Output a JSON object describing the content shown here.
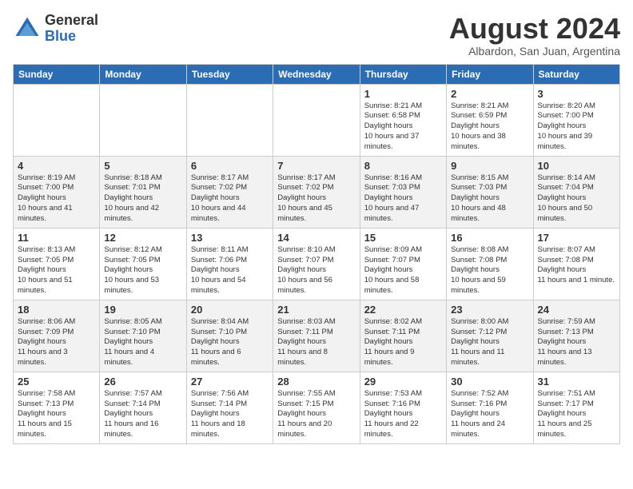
{
  "header": {
    "logo_general": "General",
    "logo_blue": "Blue",
    "month_title": "August 2024",
    "location": "Albardon, San Juan, Argentina"
  },
  "weekdays": [
    "Sunday",
    "Monday",
    "Tuesday",
    "Wednesday",
    "Thursday",
    "Friday",
    "Saturday"
  ],
  "weeks": [
    [
      null,
      null,
      null,
      null,
      {
        "day": 1,
        "sunrise": "8:21 AM",
        "sunset": "6:58 PM",
        "daylight": "10 hours and 37 minutes."
      },
      {
        "day": 2,
        "sunrise": "8:21 AM",
        "sunset": "6:59 PM",
        "daylight": "10 hours and 38 minutes."
      },
      {
        "day": 3,
        "sunrise": "8:20 AM",
        "sunset": "7:00 PM",
        "daylight": "10 hours and 39 minutes."
      }
    ],
    [
      {
        "day": 4,
        "sunrise": "8:19 AM",
        "sunset": "7:00 PM",
        "daylight": "10 hours and 41 minutes."
      },
      {
        "day": 5,
        "sunrise": "8:18 AM",
        "sunset": "7:01 PM",
        "daylight": "10 hours and 42 minutes."
      },
      {
        "day": 6,
        "sunrise": "8:17 AM",
        "sunset": "7:02 PM",
        "daylight": "10 hours and 44 minutes."
      },
      {
        "day": 7,
        "sunrise": "8:17 AM",
        "sunset": "7:02 PM",
        "daylight": "10 hours and 45 minutes."
      },
      {
        "day": 8,
        "sunrise": "8:16 AM",
        "sunset": "7:03 PM",
        "daylight": "10 hours and 47 minutes."
      },
      {
        "day": 9,
        "sunrise": "8:15 AM",
        "sunset": "7:03 PM",
        "daylight": "10 hours and 48 minutes."
      },
      {
        "day": 10,
        "sunrise": "8:14 AM",
        "sunset": "7:04 PM",
        "daylight": "10 hours and 50 minutes."
      }
    ],
    [
      {
        "day": 11,
        "sunrise": "8:13 AM",
        "sunset": "7:05 PM",
        "daylight": "10 hours and 51 minutes."
      },
      {
        "day": 12,
        "sunrise": "8:12 AM",
        "sunset": "7:05 PM",
        "daylight": "10 hours and 53 minutes."
      },
      {
        "day": 13,
        "sunrise": "8:11 AM",
        "sunset": "7:06 PM",
        "daylight": "10 hours and 54 minutes."
      },
      {
        "day": 14,
        "sunrise": "8:10 AM",
        "sunset": "7:07 PM",
        "daylight": "10 hours and 56 minutes."
      },
      {
        "day": 15,
        "sunrise": "8:09 AM",
        "sunset": "7:07 PM",
        "daylight": "10 hours and 58 minutes."
      },
      {
        "day": 16,
        "sunrise": "8:08 AM",
        "sunset": "7:08 PM",
        "daylight": "10 hours and 59 minutes."
      },
      {
        "day": 17,
        "sunrise": "8:07 AM",
        "sunset": "7:08 PM",
        "daylight": "11 hours and 1 minute."
      }
    ],
    [
      {
        "day": 18,
        "sunrise": "8:06 AM",
        "sunset": "7:09 PM",
        "daylight": "11 hours and 3 minutes."
      },
      {
        "day": 19,
        "sunrise": "8:05 AM",
        "sunset": "7:10 PM",
        "daylight": "11 hours and 4 minutes."
      },
      {
        "day": 20,
        "sunrise": "8:04 AM",
        "sunset": "7:10 PM",
        "daylight": "11 hours and 6 minutes."
      },
      {
        "day": 21,
        "sunrise": "8:03 AM",
        "sunset": "7:11 PM",
        "daylight": "11 hours and 8 minutes."
      },
      {
        "day": 22,
        "sunrise": "8:02 AM",
        "sunset": "7:11 PM",
        "daylight": "11 hours and 9 minutes."
      },
      {
        "day": 23,
        "sunrise": "8:00 AM",
        "sunset": "7:12 PM",
        "daylight": "11 hours and 11 minutes."
      },
      {
        "day": 24,
        "sunrise": "7:59 AM",
        "sunset": "7:13 PM",
        "daylight": "11 hours and 13 minutes."
      }
    ],
    [
      {
        "day": 25,
        "sunrise": "7:58 AM",
        "sunset": "7:13 PM",
        "daylight": "11 hours and 15 minutes."
      },
      {
        "day": 26,
        "sunrise": "7:57 AM",
        "sunset": "7:14 PM",
        "daylight": "11 hours and 16 minutes."
      },
      {
        "day": 27,
        "sunrise": "7:56 AM",
        "sunset": "7:14 PM",
        "daylight": "11 hours and 18 minutes."
      },
      {
        "day": 28,
        "sunrise": "7:55 AM",
        "sunset": "7:15 PM",
        "daylight": "11 hours and 20 minutes."
      },
      {
        "day": 29,
        "sunrise": "7:53 AM",
        "sunset": "7:16 PM",
        "daylight": "11 hours and 22 minutes."
      },
      {
        "day": 30,
        "sunrise": "7:52 AM",
        "sunset": "7:16 PM",
        "daylight": "11 hours and 24 minutes."
      },
      {
        "day": 31,
        "sunrise": "7:51 AM",
        "sunset": "7:17 PM",
        "daylight": "11 hours and 25 minutes."
      }
    ]
  ],
  "labels": {
    "sunrise": "Sunrise:",
    "sunset": "Sunset:",
    "daylight": "Daylight hours"
  }
}
